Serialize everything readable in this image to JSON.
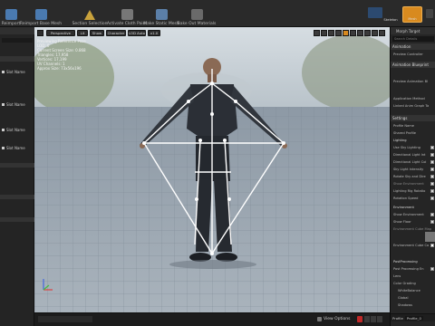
{
  "toolbar": {
    "items": [
      {
        "label": "Reimport",
        "icon": "reimport-icon"
      },
      {
        "label": "Reimport Base Mesh",
        "icon": "reimport-base-mesh-icon"
      },
      {
        "label": "Section Selection",
        "icon": "section-selection-icon"
      },
      {
        "label": "Activate Cloth Paint",
        "icon": "cloth-paint-icon"
      },
      {
        "label": "Make Static Mesh",
        "icon": "static-mesh-icon"
      },
      {
        "label": "Bake Out Materials",
        "icon": "bake-materials-icon"
      }
    ],
    "skeleton_label": "Skeleton",
    "mesh_label": "Mesh"
  },
  "left_panel": {
    "slot_name_1": "Slot Name",
    "slot_name_2": "Slot Name",
    "slot_name_3": "Slot Name",
    "slot_name_4": "Slot Name"
  },
  "viewport": {
    "perspective": "Perspective",
    "lit": "Lit",
    "show": "Show",
    "character": "Character",
    "lod": "LOD Auto",
    "speed": "x1.0",
    "stats": [
      "Previewing Reference Pose",
      "LOD: 0",
      "Current Screen Size: 0.868",
      "Triangles: 17,958",
      "Vertices: 17,199",
      "UV Channels: 1",
      "Approx Size: 73x56x196"
    ],
    "view_options": "View Options"
  },
  "right_panel": {
    "tab": "Morph Target",
    "search_placeholder": "Search Details",
    "animation_header": "Animation",
    "preview_controller": "Preview Controller",
    "animation_blueprint_header": "Animation Blueprint",
    "preview_animation_bp": "Preview Animation Bl",
    "application_method": "Application Method",
    "linked_anim_graph_tag": "Linked Anim Graph Ta",
    "settings_header": "Settings",
    "profile_name": "Profile Name",
    "shared_profile": "Shared Profile",
    "lighting_header": "Lighting",
    "rows": [
      "Use Sky Lighting",
      "Directional Light Int",
      "Directional Light Col",
      "Sky Light Intensity",
      "Rotate Sky and Dire",
      "Show Environment",
      "Lighting Rig Rotatio",
      "Rotation Speed"
    ],
    "environment_header": "Environment",
    "show_environment": "Show Environment",
    "show_floor": "Show Floor",
    "environment_cube_map": "Environment Cube Map",
    "environment_cube_color": "Environment Cube Co",
    "post_processing_header": "PostProcessing",
    "post_processing_enabled": "Post Processing En",
    "lens": "Lens",
    "color_grading": "Color Grading",
    "white_balance": "WhiteBalance",
    "global": "Global",
    "shadows": "Shadows",
    "profile_label": "Profile",
    "profile_value": "Profile_0"
  }
}
